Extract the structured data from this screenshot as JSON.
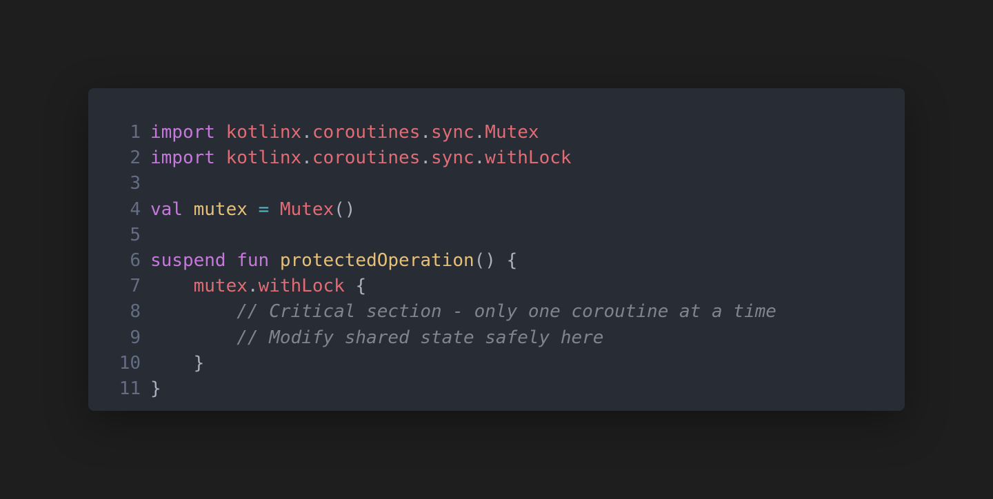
{
  "editor": {
    "lines": [
      {
        "number": "1",
        "tokens": [
          {
            "text": "import",
            "type": "keyword"
          },
          {
            "text": " ",
            "type": "plain"
          },
          {
            "text": "kotlinx",
            "type": "ident"
          },
          {
            "text": ".",
            "type": "punct"
          },
          {
            "text": "coroutines",
            "type": "ident"
          },
          {
            "text": ".",
            "type": "punct"
          },
          {
            "text": "sync",
            "type": "ident"
          },
          {
            "text": ".",
            "type": "punct"
          },
          {
            "text": "Mutex",
            "type": "ident"
          }
        ]
      },
      {
        "number": "2",
        "tokens": [
          {
            "text": "import",
            "type": "keyword"
          },
          {
            "text": " ",
            "type": "plain"
          },
          {
            "text": "kotlinx",
            "type": "ident"
          },
          {
            "text": ".",
            "type": "punct"
          },
          {
            "text": "coroutines",
            "type": "ident"
          },
          {
            "text": ".",
            "type": "punct"
          },
          {
            "text": "sync",
            "type": "ident"
          },
          {
            "text": ".",
            "type": "punct"
          },
          {
            "text": "withLock",
            "type": "ident"
          }
        ]
      },
      {
        "number": "3",
        "tokens": []
      },
      {
        "number": "4",
        "tokens": [
          {
            "text": "val",
            "type": "keyword"
          },
          {
            "text": " ",
            "type": "plain"
          },
          {
            "text": "mutex",
            "type": "func"
          },
          {
            "text": " ",
            "type": "plain"
          },
          {
            "text": "=",
            "type": "op"
          },
          {
            "text": " ",
            "type": "plain"
          },
          {
            "text": "Mutex",
            "type": "ident"
          },
          {
            "text": "()",
            "type": "punct"
          }
        ]
      },
      {
        "number": "5",
        "tokens": []
      },
      {
        "number": "6",
        "tokens": [
          {
            "text": "suspend",
            "type": "keyword"
          },
          {
            "text": " ",
            "type": "plain"
          },
          {
            "text": "fun",
            "type": "keyword"
          },
          {
            "text": " ",
            "type": "plain"
          },
          {
            "text": "protectedOperation",
            "type": "func"
          },
          {
            "text": "() {",
            "type": "punct"
          }
        ]
      },
      {
        "number": "7",
        "tokens": [
          {
            "text": "    ",
            "type": "plain"
          },
          {
            "text": "mutex",
            "type": "ident"
          },
          {
            "text": ".",
            "type": "punct"
          },
          {
            "text": "withLock",
            "type": "ident"
          },
          {
            "text": " {",
            "type": "punct"
          }
        ]
      },
      {
        "number": "8",
        "tokens": [
          {
            "text": "        ",
            "type": "plain"
          },
          {
            "text": "// Critical section - only one coroutine at a time",
            "type": "comment"
          }
        ]
      },
      {
        "number": "9",
        "tokens": [
          {
            "text": "        ",
            "type": "plain"
          },
          {
            "text": "// Modify shared state safely here",
            "type": "comment"
          }
        ]
      },
      {
        "number": "10",
        "tokens": [
          {
            "text": "    ",
            "type": "plain"
          },
          {
            "text": "}",
            "type": "punct"
          }
        ]
      },
      {
        "number": "11",
        "tokens": [
          {
            "text": "}",
            "type": "punct"
          }
        ]
      }
    ],
    "colors": {
      "background": "#1e1e1e",
      "card": "#282c34",
      "keyword": "#c678dd",
      "identifier": "#e06c75",
      "function": "#e5c07b",
      "operator": "#56b6c2",
      "punctuation": "#abb2bf",
      "comment": "#7f848e",
      "line_number": "#636d83"
    }
  }
}
